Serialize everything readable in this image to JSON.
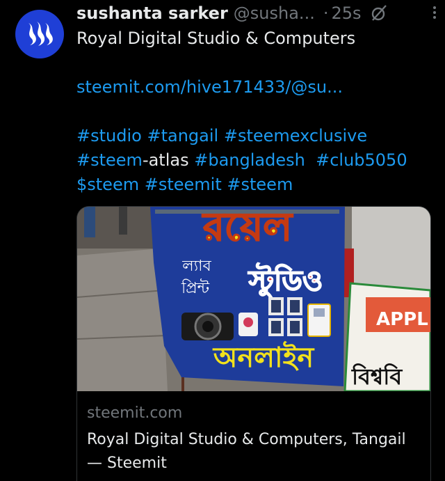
{
  "author": {
    "name": "sushanta sarker",
    "handle": "@susha...",
    "separator": "·",
    "time": "25s"
  },
  "icons": {
    "avatar": "steem-logo",
    "grok": "grok-icon",
    "more": "more-icon"
  },
  "tweet": {
    "title": "Royal Digital Studio & Computers",
    "link": "steemit.com/hive171433/@su...",
    "tags_line1": [
      "#studio",
      "#tangail",
      "#steemexclusive"
    ],
    "tags_line2_a": "#steem",
    "tags_line2_b": "-atlas",
    "tags_line2_c": [
      "#bangladesh",
      "#club5050"
    ],
    "tags_line3": [
      "$steem",
      "#steemit",
      "#steem"
    ]
  },
  "card": {
    "image_alt": "Blue shop signboard of a photo studio",
    "sign_text_top": "রয়েল",
    "sign_text_lab": "ল্যাব",
    "sign_text_print": "প্রিন্ট",
    "sign_text_studio": "স্টুডিও",
    "sign_text_online": "অনলাইন",
    "side_sign": "APPL",
    "side_sign_bottom": "বিশ্ববি",
    "domain": "steemit.com",
    "title": "Royal Digital Studio & Computers, Tangail — Steemit"
  },
  "colors": {
    "link": "#1d9bf0",
    "avatar_bg": "#1f3fd6",
    "muted": "#71767b"
  }
}
